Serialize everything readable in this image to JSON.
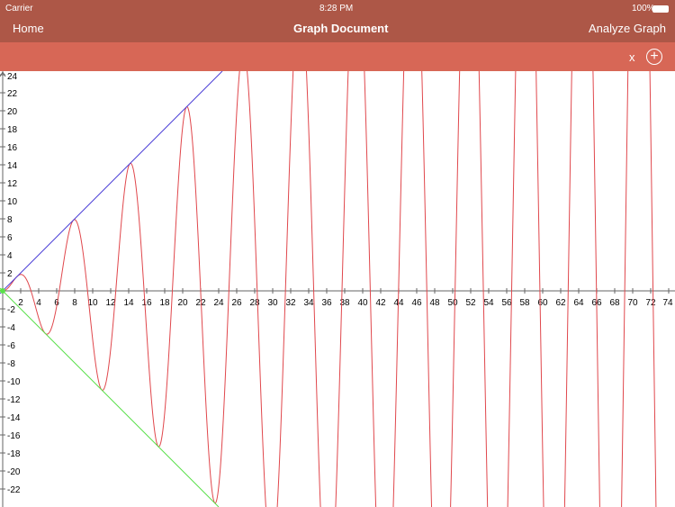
{
  "status_bar": {
    "carrier": "Carrier",
    "time": "8:28 PM",
    "battery": "100%"
  },
  "nav": {
    "home": "Home",
    "title": "Graph Document",
    "analyze": "Analyze Graph"
  },
  "toolbar": {
    "variable": "x",
    "add_icon": "plus-circle-icon"
  },
  "chart_data": {
    "type": "line",
    "xlim": [
      0,
      74.7
    ],
    "ylim": [
      -24,
      24.4
    ],
    "x_ticks": [
      2,
      4,
      6,
      8,
      10,
      12,
      14,
      16,
      18,
      20,
      22,
      24,
      26,
      28,
      30,
      32,
      34,
      36,
      38,
      40,
      42,
      44,
      46,
      48,
      50,
      52,
      54,
      56,
      58,
      60,
      62,
      64,
      66,
      68,
      70,
      72,
      74
    ],
    "y_ticks": [
      24,
      22,
      20,
      18,
      16,
      14,
      12,
      10,
      8,
      6,
      4,
      2,
      -2,
      -4,
      -6,
      -8,
      -10,
      -12,
      -14,
      -16,
      -18,
      -20,
      -22
    ],
    "series": [
      {
        "name": "x*sin(x)",
        "color": "#e0474c"
      },
      {
        "name": "x",
        "color": "#4b3fd8"
      },
      {
        "name": "-x",
        "color": "#59e04a"
      }
    ]
  }
}
